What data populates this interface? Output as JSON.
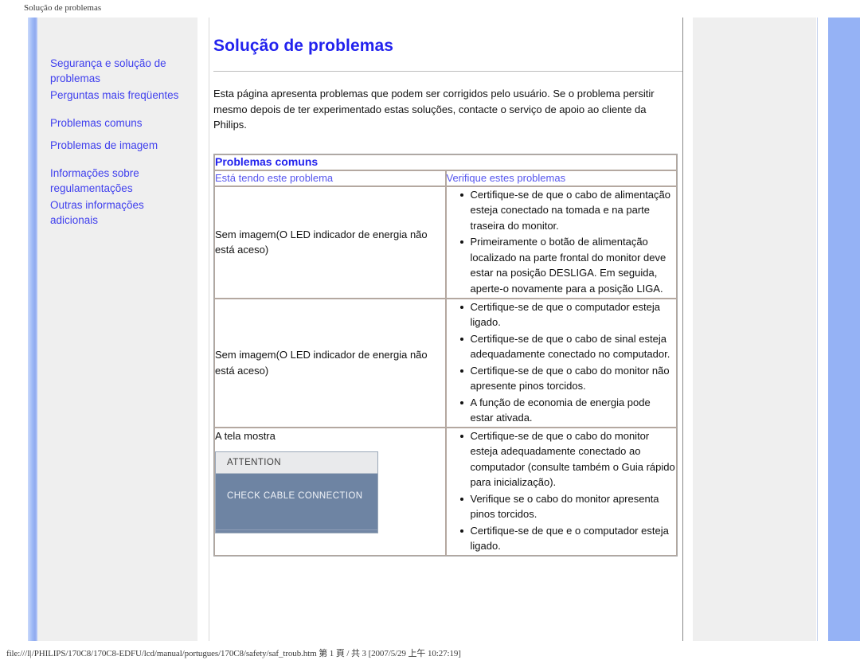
{
  "document": {
    "header_title": "Solução de problemas",
    "status_bar": "file:///I|/PHILIPS/170C8/170C8-EDFU/lcd/manual/portugues/170C8/safety/saf_troub.htm 第 1 頁 / 共 3 [2007/5/29 上午 10:27:19]"
  },
  "colors": {
    "link_blue": "#3f3fee",
    "heading_blue": "#2222ee",
    "column_head_blue": "#5555ee",
    "sidebar_bg": "#efefef",
    "accent_band": "#95b2f5",
    "monitor_body": "#6e84a3",
    "monitor_title_bg": "#e9eaec"
  },
  "sidebar": {
    "groups": [
      {
        "items": [
          {
            "label": "Segurança e solução de problemas"
          },
          {
            "label": "Perguntas mais freqüentes"
          }
        ]
      },
      {
        "items": [
          {
            "label": "Problemas comuns"
          },
          {
            "label": "Problemas de imagem"
          }
        ]
      },
      {
        "items": [
          {
            "label": "Informações sobre regulamentações"
          },
          {
            "label": "Outras informações adicionais"
          }
        ]
      }
    ]
  },
  "main": {
    "title": "Solução de problemas",
    "intro": "Esta página apresenta problemas que podem ser corrigidos pelo usuário. Se o problema persitir mesmo depois de ter experimentado estas soluções, contacte o serviço de apoio ao cliente da Philips.",
    "table": {
      "section_title": "Problemas comuns",
      "columns": [
        "Está tendo este problema",
        "Verifique estes problemas"
      ],
      "rows": [
        {
          "symptom": "Sem imagem(O LED indicador de energia não\nestá aceso)",
          "checks": [
            "Certifique-se de que o cabo de alimentação esteja conectado na tomada e na parte traseira do monitor.",
            "Primeiramente o botão de alimentação localizado na parte frontal do monitor deve estar na posição DESLIGA. Em seguida, aperte-o novamente para a posição LIGA."
          ]
        },
        {
          "symptom": "Sem imagem(O LED indicador de energia não\nestá aceso)",
          "checks": [
            "Certifique-se de que o computador esteja ligado.",
            "Certifique-se de que o cabo de sinal esteja adequadamente conectado no computador.",
            "Certifique-se de que o cabo do monitor não apresente pinos torcidos.",
            "A função de economia de energia pode estar ativada."
          ]
        },
        {
          "symptom": "A tela mostra",
          "monitor_graphic": {
            "title": "ATTENTION",
            "message": "CHECK CABLE CONNECTION"
          },
          "checks": [
            "Certifique-se de que o cabo do monitor esteja adequadamente conectado ao computador (consulte também o Guia rápido para inicialização).",
            "Verifique se o cabo do monitor apresenta pinos torcidos.",
            "Certifique-se de que e o computador esteja ligado."
          ]
        }
      ]
    }
  }
}
